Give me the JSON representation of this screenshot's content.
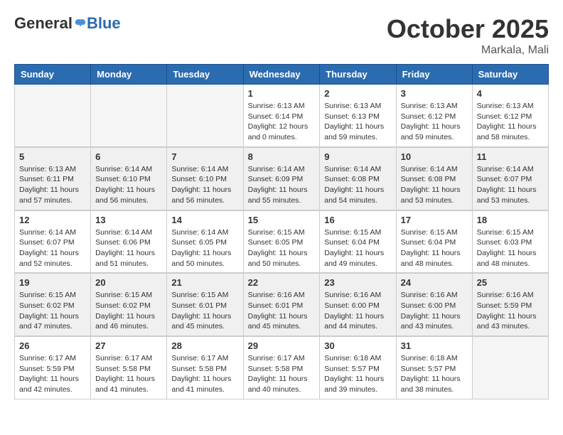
{
  "header": {
    "logo": {
      "general": "General",
      "blue": "Blue"
    },
    "month": "October 2025",
    "location": "Markala, Mali"
  },
  "weekdays": [
    "Sunday",
    "Monday",
    "Tuesday",
    "Wednesday",
    "Thursday",
    "Friday",
    "Saturday"
  ],
  "weeks": [
    [
      {
        "day": "",
        "sunrise": "",
        "sunset": "",
        "daylight": ""
      },
      {
        "day": "",
        "sunrise": "",
        "sunset": "",
        "daylight": ""
      },
      {
        "day": "",
        "sunrise": "",
        "sunset": "",
        "daylight": ""
      },
      {
        "day": "1",
        "sunrise": "Sunrise: 6:13 AM",
        "sunset": "Sunset: 6:14 PM",
        "daylight": "Daylight: 12 hours and 0 minutes."
      },
      {
        "day": "2",
        "sunrise": "Sunrise: 6:13 AM",
        "sunset": "Sunset: 6:13 PM",
        "daylight": "Daylight: 11 hours and 59 minutes."
      },
      {
        "day": "3",
        "sunrise": "Sunrise: 6:13 AM",
        "sunset": "Sunset: 6:12 PM",
        "daylight": "Daylight: 11 hours and 59 minutes."
      },
      {
        "day": "4",
        "sunrise": "Sunrise: 6:13 AM",
        "sunset": "Sunset: 6:12 PM",
        "daylight": "Daylight: 11 hours and 58 minutes."
      }
    ],
    [
      {
        "day": "5",
        "sunrise": "Sunrise: 6:13 AM",
        "sunset": "Sunset: 6:11 PM",
        "daylight": "Daylight: 11 hours and 57 minutes."
      },
      {
        "day": "6",
        "sunrise": "Sunrise: 6:14 AM",
        "sunset": "Sunset: 6:10 PM",
        "daylight": "Daylight: 11 hours and 56 minutes."
      },
      {
        "day": "7",
        "sunrise": "Sunrise: 6:14 AM",
        "sunset": "Sunset: 6:10 PM",
        "daylight": "Daylight: 11 hours and 56 minutes."
      },
      {
        "day": "8",
        "sunrise": "Sunrise: 6:14 AM",
        "sunset": "Sunset: 6:09 PM",
        "daylight": "Daylight: 11 hours and 55 minutes."
      },
      {
        "day": "9",
        "sunrise": "Sunrise: 6:14 AM",
        "sunset": "Sunset: 6:08 PM",
        "daylight": "Daylight: 11 hours and 54 minutes."
      },
      {
        "day": "10",
        "sunrise": "Sunrise: 6:14 AM",
        "sunset": "Sunset: 6:08 PM",
        "daylight": "Daylight: 11 hours and 53 minutes."
      },
      {
        "day": "11",
        "sunrise": "Sunrise: 6:14 AM",
        "sunset": "Sunset: 6:07 PM",
        "daylight": "Daylight: 11 hours and 53 minutes."
      }
    ],
    [
      {
        "day": "12",
        "sunrise": "Sunrise: 6:14 AM",
        "sunset": "Sunset: 6:07 PM",
        "daylight": "Daylight: 11 hours and 52 minutes."
      },
      {
        "day": "13",
        "sunrise": "Sunrise: 6:14 AM",
        "sunset": "Sunset: 6:06 PM",
        "daylight": "Daylight: 11 hours and 51 minutes."
      },
      {
        "day": "14",
        "sunrise": "Sunrise: 6:14 AM",
        "sunset": "Sunset: 6:05 PM",
        "daylight": "Daylight: 11 hours and 50 minutes."
      },
      {
        "day": "15",
        "sunrise": "Sunrise: 6:15 AM",
        "sunset": "Sunset: 6:05 PM",
        "daylight": "Daylight: 11 hours and 50 minutes."
      },
      {
        "day": "16",
        "sunrise": "Sunrise: 6:15 AM",
        "sunset": "Sunset: 6:04 PM",
        "daylight": "Daylight: 11 hours and 49 minutes."
      },
      {
        "day": "17",
        "sunrise": "Sunrise: 6:15 AM",
        "sunset": "Sunset: 6:04 PM",
        "daylight": "Daylight: 11 hours and 48 minutes."
      },
      {
        "day": "18",
        "sunrise": "Sunrise: 6:15 AM",
        "sunset": "Sunset: 6:03 PM",
        "daylight": "Daylight: 11 hours and 48 minutes."
      }
    ],
    [
      {
        "day": "19",
        "sunrise": "Sunrise: 6:15 AM",
        "sunset": "Sunset: 6:02 PM",
        "daylight": "Daylight: 11 hours and 47 minutes."
      },
      {
        "day": "20",
        "sunrise": "Sunrise: 6:15 AM",
        "sunset": "Sunset: 6:02 PM",
        "daylight": "Daylight: 11 hours and 46 minutes."
      },
      {
        "day": "21",
        "sunrise": "Sunrise: 6:15 AM",
        "sunset": "Sunset: 6:01 PM",
        "daylight": "Daylight: 11 hours and 45 minutes."
      },
      {
        "day": "22",
        "sunrise": "Sunrise: 6:16 AM",
        "sunset": "Sunset: 6:01 PM",
        "daylight": "Daylight: 11 hours and 45 minutes."
      },
      {
        "day": "23",
        "sunrise": "Sunrise: 6:16 AM",
        "sunset": "Sunset: 6:00 PM",
        "daylight": "Daylight: 11 hours and 44 minutes."
      },
      {
        "day": "24",
        "sunrise": "Sunrise: 6:16 AM",
        "sunset": "Sunset: 6:00 PM",
        "daylight": "Daylight: 11 hours and 43 minutes."
      },
      {
        "day": "25",
        "sunrise": "Sunrise: 6:16 AM",
        "sunset": "Sunset: 5:59 PM",
        "daylight": "Daylight: 11 hours and 43 minutes."
      }
    ],
    [
      {
        "day": "26",
        "sunrise": "Sunrise: 6:17 AM",
        "sunset": "Sunset: 5:59 PM",
        "daylight": "Daylight: 11 hours and 42 minutes."
      },
      {
        "day": "27",
        "sunrise": "Sunrise: 6:17 AM",
        "sunset": "Sunset: 5:58 PM",
        "daylight": "Daylight: 11 hours and 41 minutes."
      },
      {
        "day": "28",
        "sunrise": "Sunrise: 6:17 AM",
        "sunset": "Sunset: 5:58 PM",
        "daylight": "Daylight: 11 hours and 41 minutes."
      },
      {
        "day": "29",
        "sunrise": "Sunrise: 6:17 AM",
        "sunset": "Sunset: 5:58 PM",
        "daylight": "Daylight: 11 hours and 40 minutes."
      },
      {
        "day": "30",
        "sunrise": "Sunrise: 6:18 AM",
        "sunset": "Sunset: 5:57 PM",
        "daylight": "Daylight: 11 hours and 39 minutes."
      },
      {
        "day": "31",
        "sunrise": "Sunrise: 6:18 AM",
        "sunset": "Sunset: 5:57 PM",
        "daylight": "Daylight: 11 hours and 38 minutes."
      },
      {
        "day": "",
        "sunrise": "",
        "sunset": "",
        "daylight": ""
      }
    ]
  ]
}
